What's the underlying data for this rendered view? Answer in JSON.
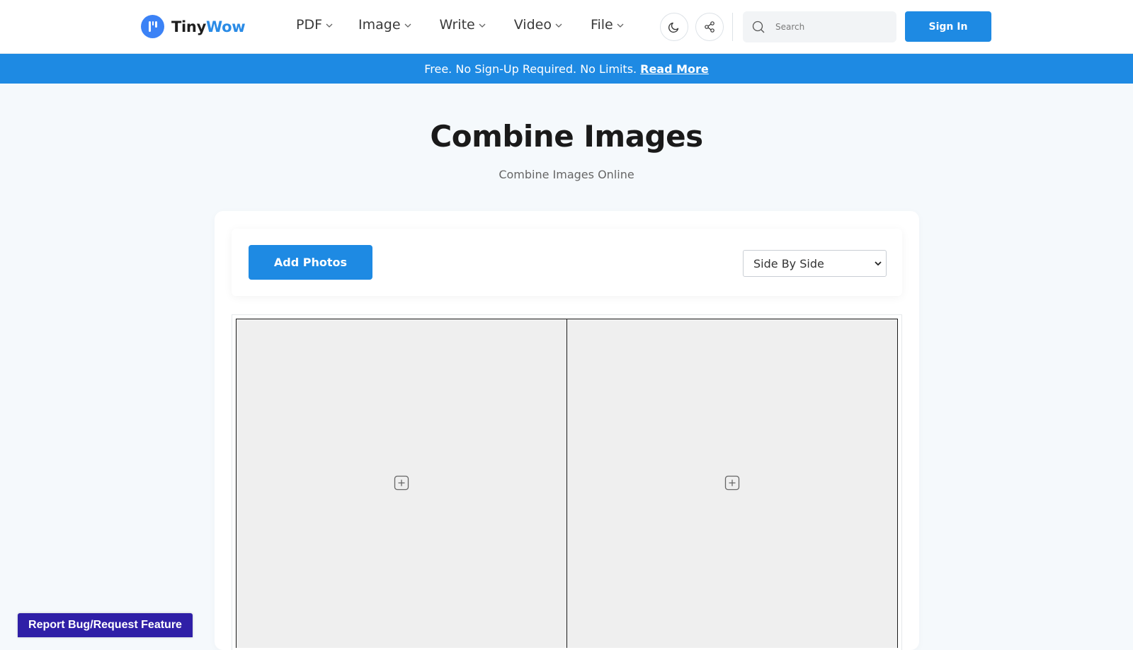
{
  "header": {
    "logo": {
      "part1": "Tiny",
      "part2": "Wow"
    },
    "nav": [
      {
        "label": "PDF"
      },
      {
        "label": "Image"
      },
      {
        "label": "Write"
      },
      {
        "label": "Video"
      },
      {
        "label": "File"
      }
    ],
    "search": {
      "placeholder": "Search"
    },
    "signin_label": "Sign In"
  },
  "banner": {
    "text": "Free. No Sign-Up Required. No Limits.",
    "link": "Read More"
  },
  "page": {
    "title": "Combine Images",
    "subtitle": "Combine Images Online"
  },
  "toolbar": {
    "add_label": "Add Photos",
    "layout_selected": "Side By Side"
  },
  "report_label": "Report Bug/Request Feature",
  "colors": {
    "accent": "#1e8ae3",
    "report": "#2f1fa7"
  }
}
